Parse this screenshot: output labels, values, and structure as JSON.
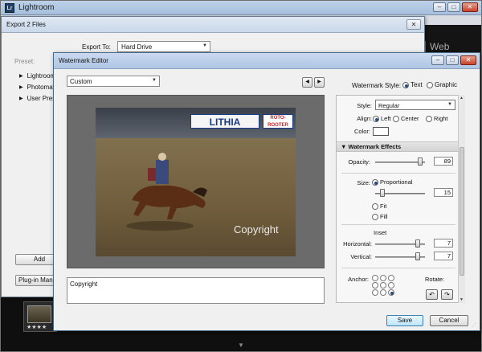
{
  "lightroom": {
    "app_title": "Lightroom",
    "logo_text": "Lr",
    "module": "Web",
    "filmstrip_stars": "★★★★"
  },
  "export_dialog": {
    "title": "Export 2 Files",
    "export_to_label": "Export To:",
    "export_to_value": "Hard Drive",
    "preset_label": "Preset:",
    "tree_items": [
      "Lightroom",
      "Photomat",
      "User Pres"
    ],
    "add_label": "Add",
    "plugin_label": "Plug-in Manager..."
  },
  "watermark_editor": {
    "title": "Watermark Editor",
    "preset_value": "Custom",
    "photo_signs": [
      "LITHIA",
      "ROTO-ROOTER"
    ],
    "watermark_preview_text": "Copyright",
    "text_value": "Copyright",
    "watermark_style_label": "Watermark Style:",
    "style_options": [
      {
        "label": "Text",
        "selected": true
      },
      {
        "label": "Graphic",
        "selected": false
      }
    ],
    "panel": {
      "style_label": "Style:",
      "style_value": "Regular",
      "align_label": "Align:",
      "align_options": [
        {
          "label": "Left",
          "selected": true
        },
        {
          "label": "Center",
          "selected": false
        },
        {
          "label": "Right",
          "selected": false
        }
      ],
      "color_label": "Color:",
      "color_value": "#ffffff",
      "effects_header": "Watermark Effects",
      "opacity_label": "Opacity:",
      "opacity_value": "89",
      "size_label": "Size:",
      "proportional_label": "Proportional",
      "size_value": "15",
      "fit_label": "Fit",
      "fill_label": "Fill",
      "inset_label": "Inset",
      "horizontal_label": "Horizontal:",
      "horizontal_value": "7",
      "vertical_label": "Vertical:",
      "vertical_value": "7",
      "anchor_label": "Anchor:",
      "rotate_label": "Rotate:"
    },
    "save_label": "Save",
    "cancel_label": "Cancel"
  }
}
